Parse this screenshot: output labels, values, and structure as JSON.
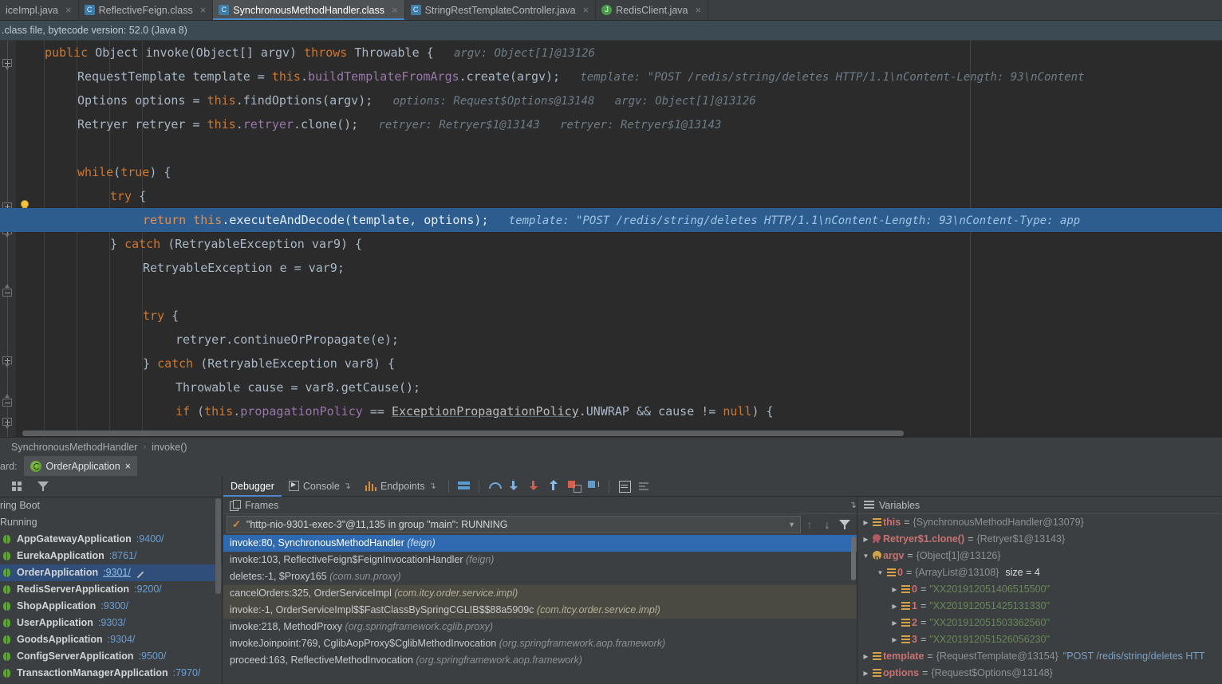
{
  "tabs": [
    {
      "label": "iceImpl.java",
      "icon": "java-file-icon",
      "active": false,
      "closable": true
    },
    {
      "label": "ReflectiveFeign.class",
      "icon": "class-file-icon",
      "active": false,
      "closable": true
    },
    {
      "label": "SynchronousMethodHandler.class",
      "icon": "class-file-icon",
      "active": true,
      "closable": true
    },
    {
      "label": "StringRestTemplateController.java",
      "icon": "class-file-icon",
      "active": false,
      "closable": true
    },
    {
      "label": "RedisClient.java",
      "icon": "java-file-icon",
      "active": false,
      "closable": true
    }
  ],
  "notice": {
    "text": ".class file, bytecode version: 52.0 (Java 8)"
  },
  "editor": {
    "lines": [
      {
        "indent": 0,
        "tokens": [
          {
            "c": "kw",
            "t": "public "
          },
          {
            "c": "typ",
            "t": "Object "
          },
          {
            "c": "txt",
            "t": "invoke"
          },
          {
            "c": "txt",
            "t": "("
          },
          {
            "c": "typ",
            "t": "Object"
          },
          {
            "c": "txt",
            "t": "[] argv) "
          },
          {
            "c": "kw",
            "t": "throws "
          },
          {
            "c": "typ",
            "t": "Throwable "
          },
          {
            "c": "txt",
            "t": "{"
          },
          {
            "c": "hint",
            "t": "   argv: Object[1]@13126"
          }
        ]
      },
      {
        "indent": 1,
        "tokens": [
          {
            "c": "typ",
            "t": "RequestTemplate "
          },
          {
            "c": "txt",
            "t": "template = "
          },
          {
            "c": "kw",
            "t": "this"
          },
          {
            "c": "txt",
            "t": "."
          },
          {
            "c": "fld",
            "t": "buildTemplateFromArgs"
          },
          {
            "c": "txt",
            "t": ".create(argv);"
          },
          {
            "c": "hint",
            "t": "   template: \"POST /redis/string/deletes HTTP/1.1\\nContent-Length: 93\\nContent"
          }
        ]
      },
      {
        "indent": 1,
        "tokens": [
          {
            "c": "typ",
            "t": "Options "
          },
          {
            "c": "txt",
            "t": "options = "
          },
          {
            "c": "kw",
            "t": "this"
          },
          {
            "c": "txt",
            "t": ".findOptions(argv);"
          },
          {
            "c": "hint",
            "t": "   options: Request$Options@13148   argv: Object[1]@13126"
          }
        ]
      },
      {
        "indent": 1,
        "tokens": [
          {
            "c": "typ",
            "t": "Retryer "
          },
          {
            "c": "txt",
            "t": "retryer = "
          },
          {
            "c": "kw",
            "t": "this"
          },
          {
            "c": "txt",
            "t": "."
          },
          {
            "c": "fld",
            "t": "retryer"
          },
          {
            "c": "txt",
            "t": ".clone();"
          },
          {
            "c": "hint",
            "t": "   retryer: Retryer$1@13143   retryer: Retryer$1@13143"
          }
        ]
      },
      {
        "indent": 0,
        "tokens": []
      },
      {
        "indent": 1,
        "tokens": [
          {
            "c": "kw",
            "t": "while"
          },
          {
            "c": "txt",
            "t": "("
          },
          {
            "c": "kw",
            "t": "true"
          },
          {
            "c": "txt",
            "t": ") {"
          }
        ]
      },
      {
        "indent": 2,
        "tokens": [
          {
            "c": "kw",
            "t": "try "
          },
          {
            "c": "txt",
            "t": "{"
          }
        ]
      },
      {
        "indent": 3,
        "highlight": true,
        "tokens": [
          {
            "c": "kw",
            "t": "return "
          },
          {
            "c": "kw",
            "t": "this"
          },
          {
            "c": "txt",
            "t": ".executeAndDecode(template, options);"
          },
          {
            "c": "hint",
            "t": "   template: \"POST /redis/string/deletes HTTP/1.1\\nContent-Length: 93\\nContent-Type: app"
          }
        ]
      },
      {
        "indent": 2,
        "tokens": [
          {
            "c": "txt",
            "t": "} "
          },
          {
            "c": "kw",
            "t": "catch "
          },
          {
            "c": "txt",
            "t": "(RetryableException var9) {"
          }
        ]
      },
      {
        "indent": 3,
        "tokens": [
          {
            "c": "typ",
            "t": "RetryableException "
          },
          {
            "c": "txt",
            "t": "e = var9;"
          }
        ]
      },
      {
        "indent": 0,
        "tokens": []
      },
      {
        "indent": 3,
        "tokens": [
          {
            "c": "kw",
            "t": "try "
          },
          {
            "c": "txt",
            "t": "{"
          }
        ]
      },
      {
        "indent": 4,
        "tokens": [
          {
            "c": "txt",
            "t": "retryer.continueOrPropagate(e);"
          }
        ]
      },
      {
        "indent": 3,
        "tokens": [
          {
            "c": "txt",
            "t": "} "
          },
          {
            "c": "kw",
            "t": "catch "
          },
          {
            "c": "txt",
            "t": "(RetryableException var8) {"
          }
        ]
      },
      {
        "indent": 4,
        "tokens": [
          {
            "c": "typ",
            "t": "Throwable "
          },
          {
            "c": "txt",
            "t": "cause = var8.getCause();"
          }
        ]
      },
      {
        "indent": 4,
        "tokens": [
          {
            "c": "kw",
            "t": "if "
          },
          {
            "c": "txt",
            "t": "("
          },
          {
            "c": "kw",
            "t": "this"
          },
          {
            "c": "txt",
            "t": "."
          },
          {
            "c": "fld",
            "t": "propagationPolicy"
          },
          {
            "c": "txt",
            "t": " == "
          },
          {
            "c": "under",
            "t": "ExceptionPropagationPolicy"
          },
          {
            "c": "txt",
            "t": ".UNWRAP && cause != "
          },
          {
            "c": "kw",
            "t": "null"
          },
          {
            "c": "txt",
            "t": ") {"
          }
        ]
      }
    ]
  },
  "breadcrumb": {
    "class": "SynchronousMethodHandler",
    "separator": "›",
    "method": "invoke()"
  },
  "run_tab_row": {
    "lead_label": "ard:",
    "tab_label": "OrderApplication",
    "close": "×"
  },
  "services": {
    "toolbar": {
      "group_icon": "group-by-icon",
      "filter_icon": "filter-icon"
    },
    "root_label": "ring Boot",
    "status_label": "Running",
    "items": [
      {
        "name": "AppGatewayApplication",
        "port": ":9400/",
        "selected": false
      },
      {
        "name": "EurekaApplication",
        "port": ":8761/",
        "selected": false
      },
      {
        "name": "OrderApplication",
        "port": ":9301/",
        "selected": true
      },
      {
        "name": "RedisServerApplication",
        "port": ":9200/",
        "selected": false
      },
      {
        "name": "ShopApplication",
        "port": ":9300/",
        "selected": false
      },
      {
        "name": "UserApplication",
        "port": ":9303/",
        "selected": false
      },
      {
        "name": "GoodsApplication",
        "port": ":9304/",
        "selected": false
      },
      {
        "name": "ConfigServerApplication",
        "port": ":9500/",
        "selected": false
      },
      {
        "name": "TransactionManagerApplication",
        "port": ":7970/",
        "selected": false
      }
    ]
  },
  "debugger": {
    "tabs": [
      {
        "label": "Debugger",
        "active": true,
        "icon": null,
        "pin": false
      },
      {
        "label": "Console",
        "active": false,
        "icon": "console-icon",
        "pin": true
      },
      {
        "label": "Endpoints",
        "active": false,
        "icon": "endpoints-icon",
        "pin": true
      }
    ],
    "toolbar_icons": [
      "restore-layout-icon",
      "step-over-icon",
      "step-into-icon",
      "force-step-into-icon",
      "step-out-icon",
      "drop-frame-icon",
      "run-to-cursor-icon",
      "evaluate-expression-icon",
      "layout-settings-icon"
    ],
    "frames": {
      "title": "Frames",
      "pin": "↴",
      "thread": "\"http-nio-9301-exec-3\"@11,135 in group \"main\": RUNNING",
      "thread_status_icon": "running-check-icon",
      "dropdown_caret": "▼",
      "up_button": "↑",
      "down_button": "↓",
      "filter_icon": "filter-icon",
      "rows": [
        {
          "method": "invoke:80, SynchronousMethodHandler",
          "pkg": "(feign)",
          "state": "selected"
        },
        {
          "method": "invoke:103, ReflectiveFeign$FeignInvocationHandler",
          "pkg": "(feign)",
          "state": "normal"
        },
        {
          "method": "deletes:-1, $Proxy165",
          "pkg": "(com.sun.proxy)",
          "state": "normal"
        },
        {
          "method": "cancelOrders:325, OrderServiceImpl",
          "pkg": "(com.itcy.order.service.impl)",
          "state": "shaded"
        },
        {
          "method": "invoke:-1, OrderServiceImpl$$FastClassBySpringCGLIB$$88a5909c",
          "pkg": "(com.itcy.order.service.impl)",
          "state": "shaded"
        },
        {
          "method": "invoke:218, MethodProxy",
          "pkg": "(org.springframework.cglib.proxy)",
          "state": "normal"
        },
        {
          "method": "invokeJoinpoint:769, CglibAopProxy$CglibMethodInvocation",
          "pkg": "(org.springframework.aop.framework)",
          "state": "normal"
        },
        {
          "method": "proceed:163, ReflectiveMethodInvocation",
          "pkg": "(org.springframework.aop.framework)",
          "state": "normal"
        }
      ]
    },
    "variables": {
      "title": "Variables",
      "rows": [
        {
          "indent": 1,
          "tri": "▶",
          "icon": "field-icon",
          "name": "this",
          "eq": "=",
          "value": "{SynchronousMethodHandler@13079}"
        },
        {
          "indent": 1,
          "tri": "▶",
          "icon": "method-icon",
          "name": "Retryer$1.clone()",
          "eq": "=",
          "value": "{Retryer$1@13143}"
        },
        {
          "indent": 1,
          "tri": "▼",
          "icon": "param-icon",
          "name": "argv",
          "eq": "=",
          "value": "{Object[1]@13126}"
        },
        {
          "indent": 2,
          "tri": "▼",
          "icon": "field-icon",
          "name": "0",
          "eq": "=",
          "value": "{ArrayList@13108}",
          "size": "size = 4"
        },
        {
          "indent": 3,
          "tri": "▶",
          "icon": "field-icon",
          "name": "0",
          "eq": "=",
          "str": "\"XX201912051406515500\""
        },
        {
          "indent": 3,
          "tri": "▶",
          "icon": "field-icon",
          "name": "1",
          "eq": "=",
          "str": "\"XX201912051425131330\""
        },
        {
          "indent": 3,
          "tri": "▶",
          "icon": "field-icon",
          "name": "2",
          "eq": "=",
          "str": "\"XX201912051503362560\""
        },
        {
          "indent": 3,
          "tri": "▶",
          "icon": "field-icon",
          "name": "3",
          "eq": "=",
          "str": "\"XX201912051526056230\""
        },
        {
          "indent": 1,
          "tri": "▶",
          "icon": "field-icon",
          "name": "template",
          "eq": "=",
          "value": "{RequestTemplate@13154}",
          "tail": "\"POST /redis/string/deletes HTT"
        },
        {
          "indent": 1,
          "tri": "▶",
          "icon": "field-icon",
          "name": "options",
          "eq": "=",
          "value": "{Request$Options@13148}"
        }
      ]
    }
  },
  "colors": {
    "accent": "#4a88c7",
    "selection": "#2d5c8f",
    "frame_selected": "#2f6ab0",
    "frame_shaded": "#4a4a42",
    "editor_bg": "#2b2b2b",
    "panel_bg": "#3c3f41",
    "keyword": "#cc7832",
    "string": "#6a8759",
    "field": "#9876aa",
    "hint": "#6e7d88"
  }
}
